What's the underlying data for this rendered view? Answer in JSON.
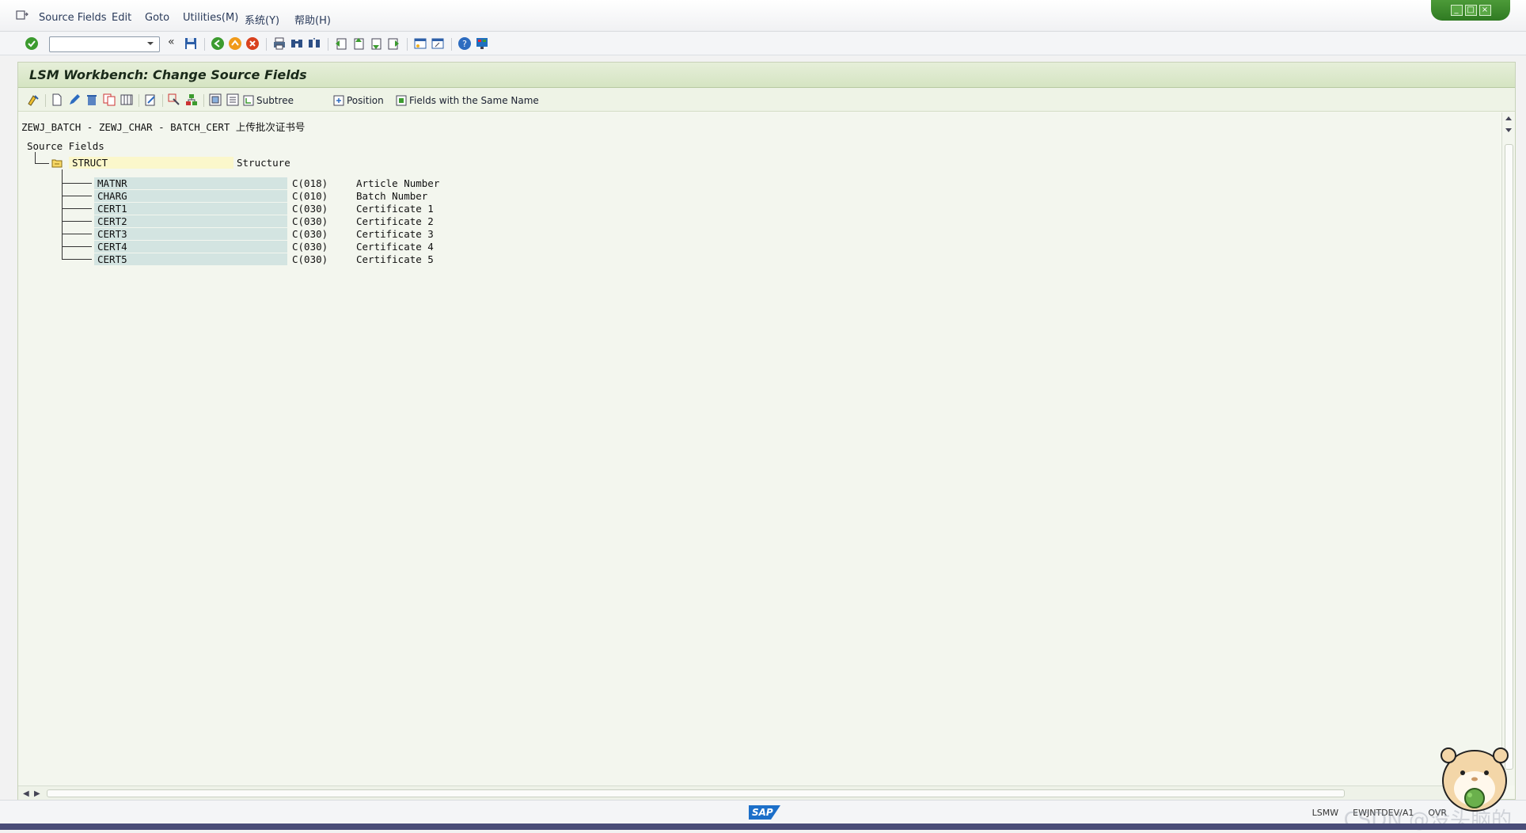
{
  "menu": {
    "items": [
      {
        "label": "Source Fields"
      },
      {
        "label": "Edit"
      },
      {
        "label": "Goto"
      },
      {
        "label": "Utilities(M)"
      },
      {
        "label": "系统(Y)"
      },
      {
        "label": "帮助(H)"
      }
    ]
  },
  "window": {
    "controls": [
      "_",
      "□",
      "×"
    ]
  },
  "command_field": {
    "value": ""
  },
  "screen": {
    "title": "LSM Workbench: Change Source Fields"
  },
  "app_toolbar": {
    "subtree_label": "Subtree",
    "position_label": "Position",
    "same_name_label": "Fields with the Same Name"
  },
  "content": {
    "header": "ZEWJ_BATCH - ZEWJ_CHAR - BATCH_CERT 上传批次证书号",
    "root_label": "Source Fields",
    "structure": {
      "name": "STRUCT",
      "description": "Structure"
    },
    "fields": [
      {
        "name": "MATNR",
        "type": "C(018)",
        "description": "Article Number"
      },
      {
        "name": "CHARG",
        "type": "C(010)",
        "description": "Batch Number"
      },
      {
        "name": "CERT1",
        "type": "C(030)",
        "description": "Certificate 1"
      },
      {
        "name": "CERT2",
        "type": "C(030)",
        "description": "Certificate 2"
      },
      {
        "name": "CERT3",
        "type": "C(030)",
        "description": "Certificate 3"
      },
      {
        "name": "CERT4",
        "type": "C(030)",
        "description": "Certificate 4"
      },
      {
        "name": "CERT5",
        "type": "C(030)",
        "description": "Certificate 5"
      }
    ]
  },
  "status": {
    "logo": "SAP",
    "transaction": "LSMW",
    "system": "EWJNTDEV/A1",
    "mode": "OVR",
    "watermark": "CSDN @没头脑的"
  },
  "colors": {
    "title_bg": "#dbe8cb",
    "struct_field_bg": "#fbf7cb",
    "field_bg": "#d3e4e1",
    "accent_green": "#3b8a2c"
  }
}
